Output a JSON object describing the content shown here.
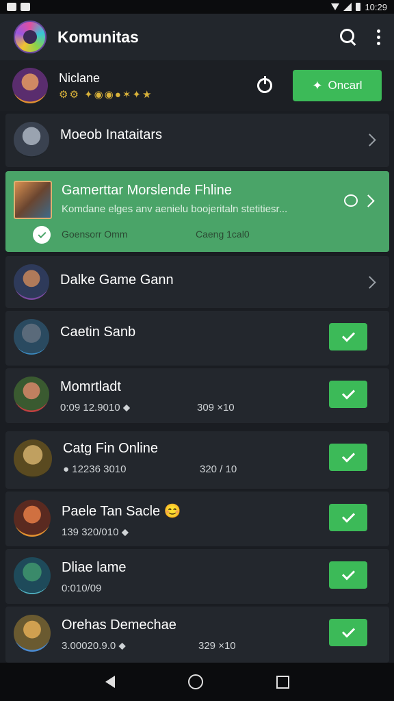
{
  "status_bar": {
    "time": "10:29"
  },
  "app": {
    "title": "Komunitas"
  },
  "profile": {
    "name": "Niclane",
    "badges": "⚙⚙ ✦◉◉●✶✦★",
    "join_label": "Oncarl"
  },
  "featured": {
    "title": "Gamerttar Morslende Fhline",
    "desc": "Komdane elges anv aenielu boojeritaln stetitiesr...",
    "stat_left": "Goensorr Omm",
    "stat_right": "Caeng 1cal0"
  },
  "items": [
    {
      "title": "Moeob Inataitars",
      "sub_amt": "",
      "sub_val": ""
    },
    {
      "title": "Dalke Game Gann",
      "sub_amt": "",
      "sub_val": ""
    },
    {
      "title": "Caetin Sanb",
      "sub_amt": "",
      "sub_val": ""
    },
    {
      "title": "Momrtladt",
      "sub_amt": "0:09 12.9010 ⬥",
      "sub_val": "309 ×10"
    },
    {
      "title": "Catg Fin Online",
      "sub_amt": "● 12236 3010",
      "sub_val": "320 / 10"
    },
    {
      "title": "Paele Tan Sacle 😊",
      "sub_amt": "139 320/010 ⬥",
      "sub_val": ""
    },
    {
      "title": "Dliae lame",
      "sub_amt": "0:010/09",
      "sub_val": ""
    },
    {
      "title": "Orehas Demechae",
      "sub_amt": "3.00020.9.0 ⬥",
      "sub_val": "329 ×10"
    }
  ],
  "colors": {
    "accent_green": "#3cba58",
    "featured_bg": "#4aa468",
    "card_bg": "#23272d"
  }
}
